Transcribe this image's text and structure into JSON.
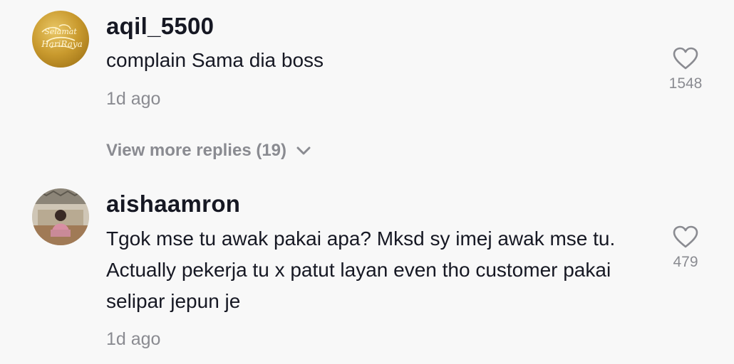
{
  "comments": [
    {
      "username": "aqil_5500",
      "text": "complain Sama dia boss",
      "time": "1d ago",
      "likes": "1548",
      "avatar_icon": "selamat-hari-raya-avatar",
      "avatar_text": "Selamat Hari Raya"
    },
    {
      "username": "aishaamron",
      "text": "Tgok mse tu awak pakai apa? Mksd sy imej awak mse tu. Actually pekerja tu x patut layan even tho customer pakai selipar jepun je",
      "time": "1d ago",
      "likes": "479",
      "avatar_icon": "user-photo-avatar"
    }
  ],
  "view_more_replies": "View more replies (19)",
  "icons": {
    "like": "heart-outline-icon",
    "expand": "chevron-down-icon"
  },
  "colors": {
    "background": "#f8f8f8",
    "primary_text": "#161823",
    "secondary_text": "#8a8b91",
    "icon_gray": "#8a8b91"
  }
}
